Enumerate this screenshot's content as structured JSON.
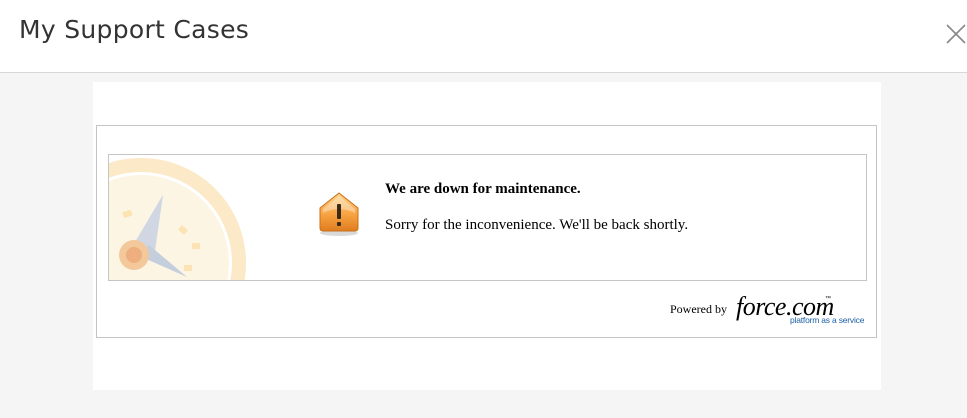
{
  "header": {
    "title": "My Support Cases",
    "close_icon": "close-icon"
  },
  "maintenance": {
    "title": "We are down for maintenance.",
    "message": "Sorry for the inconvenience. We'll be back shortly.",
    "warning_icon": "warning-icon",
    "background_icon": "compass-icon"
  },
  "footer": {
    "powered_by": "Powered by",
    "logo_name": "force.com",
    "logo_tm": "™",
    "logo_tagline": "platform as a service"
  },
  "colors": {
    "page_background": "#f5f5f5",
    "panel_background": "#ffffff",
    "border": "#c4c4c4",
    "warning_orange": "#f59a3b",
    "tagline_blue": "#1d5fa6"
  }
}
